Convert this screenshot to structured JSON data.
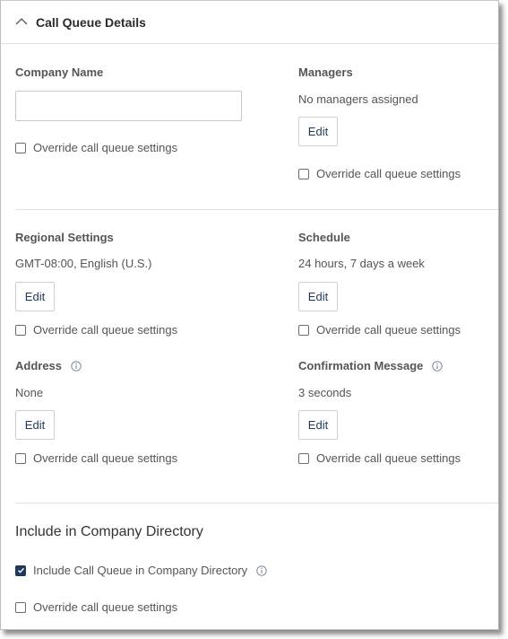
{
  "header": {
    "title": "Call Queue Details",
    "collapse_icon": "chevron-up-icon"
  },
  "override_label": "Override call queue settings",
  "edit_label": "Edit",
  "company_name": {
    "label": "Company Name",
    "value": "",
    "placeholder": "",
    "override_checked": false
  },
  "managers": {
    "label": "Managers",
    "value": "No managers assigned",
    "override_checked": false
  },
  "regional_settings": {
    "label": "Regional Settings",
    "value": "GMT-08:00, English (U.S.)",
    "override_checked": false
  },
  "schedule": {
    "label": "Schedule",
    "value": "24 hours, 7 days a week",
    "override_checked": false
  },
  "address": {
    "label": "Address",
    "value": "None",
    "info_icon": "info-icon",
    "override_checked": false
  },
  "confirmation_message": {
    "label": "Confirmation Message",
    "value": "3 seconds",
    "info_icon": "info-icon",
    "override_checked": false
  },
  "directory": {
    "title": "Include in Company Directory",
    "include_label": "Include Call Queue in Company Directory",
    "include_checked": true,
    "override_checked": false
  },
  "colors": {
    "accent": "#1d3a5c",
    "text": "#555555",
    "divider": "#e1e1e1"
  }
}
